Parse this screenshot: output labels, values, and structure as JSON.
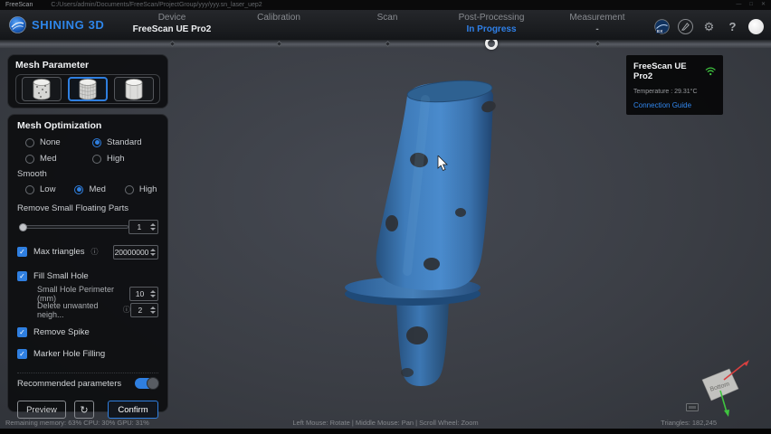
{
  "titlebar": {
    "app_name": "FreeScan",
    "file_path": "C:/Users/admin/Documents/FreeScan/ProjectGroup/yyy/yyy.sn_laser_uep2",
    "controls": [
      "—",
      "□",
      "✕"
    ]
  },
  "brand": {
    "name": "SHINING 3D"
  },
  "nav": {
    "tabs": [
      {
        "label": "Device",
        "sub": "FreeScan UE Pro2"
      },
      {
        "label": "Calibration",
        "sub": ""
      },
      {
        "label": "Scan",
        "sub": ""
      },
      {
        "label": "Post-Processing",
        "sub": "In Progress"
      },
      {
        "label": "Measurement",
        "sub": "-"
      }
    ],
    "current_step": "Post-Processing"
  },
  "topbar": {
    "ex_label": "EX",
    "gear_glyph": "⚙",
    "help_glyph": "?"
  },
  "device_panel": {
    "name": "FreeScan UE Pro2",
    "temperature": "Temperature : 29.31°C",
    "link": "Connection Guide"
  },
  "mesh_parameter": {
    "title": "Mesh Parameter",
    "selected_option_index": 1
  },
  "mesh_optimization": {
    "title": "Mesh Optimization",
    "quality": {
      "options": [
        "None",
        "Standard",
        "Med",
        "High"
      ],
      "selected": "Standard"
    },
    "smooth": {
      "label": "Smooth",
      "options": [
        "Low",
        "Med",
        "High"
      ],
      "selected": "Med"
    },
    "remove_small_floating_parts": {
      "label": "Remove Small Floating Parts",
      "value": "1"
    },
    "max_triangles": {
      "label": "Max triangles",
      "checked": true,
      "value": "20000000"
    },
    "fill_small_hole": {
      "label": "Fill Small Hole",
      "checked": true
    },
    "small_hole_perimeter": {
      "label": "Small Hole Perimeter (mm)",
      "value": "10"
    },
    "delete_unwanted_neighbors": {
      "label": "Delete unwanted neigh...",
      "value": "2"
    },
    "remove_spike": {
      "label": "Remove Spike",
      "checked": true
    },
    "marker_hole_filling": {
      "label": "Marker Hole Filling",
      "checked": true
    },
    "recommended_parameters": {
      "label": "Recommended parameters",
      "on": true
    },
    "buttons": {
      "preview": "Preview",
      "confirm": "Confirm"
    }
  },
  "viewport": {
    "axis_plane_label": "Bottom",
    "hint": "Left Mouse: Rotate | Middle Mouse: Pan | Scroll Wheel: Zoom"
  },
  "statusbar": {
    "left": "Remaining memory: 63% CPU: 30% GPU: 31%",
    "right": "Triangles: 182,245"
  },
  "icons": {
    "check": "✓",
    "info": "ⓘ",
    "refresh": "↻"
  },
  "colors": {
    "accent_blue": "#2f7fe0",
    "in_progress_blue": "#2f80e8",
    "link_blue": "#3187ee",
    "wifi_green": "#3fc43f",
    "object_blue": "#4a8bcd",
    "viewport_gray": "#3b3e45",
    "panel_bg": "#0e0f11"
  }
}
